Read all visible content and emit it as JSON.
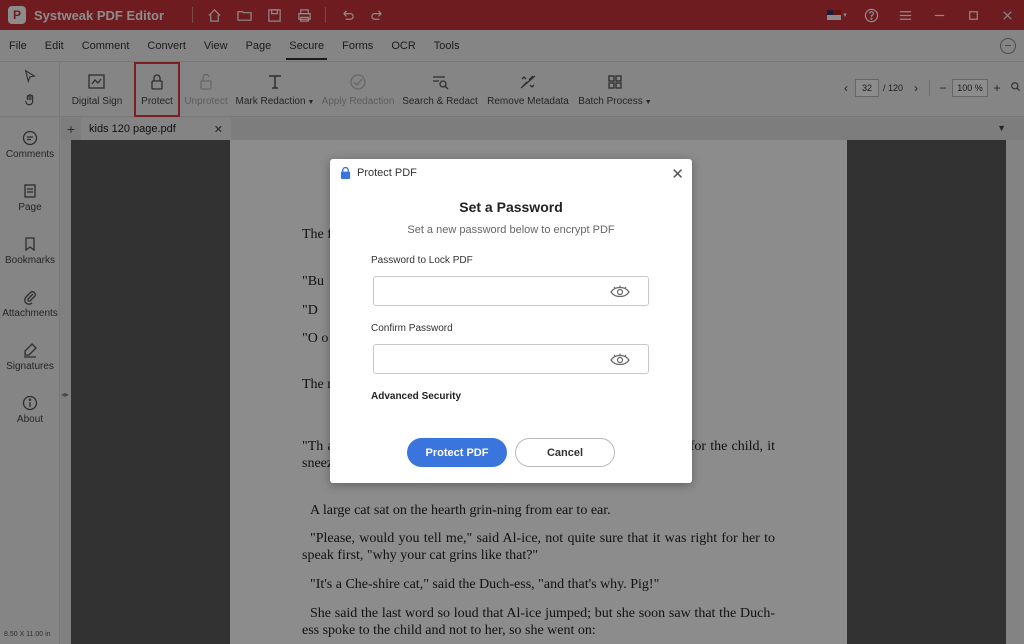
{
  "app": {
    "title": "Systweak PDF Editor"
  },
  "menu": [
    "File",
    "Edit",
    "Comment",
    "Convert",
    "View",
    "Page",
    "Secure",
    "Forms",
    "OCR",
    "Tools"
  ],
  "ribbon": {
    "tools": [
      {
        "label": "Digital Sign"
      },
      {
        "label": "Protect"
      },
      {
        "label": "Unprotect"
      },
      {
        "label": "Mark Redaction"
      },
      {
        "label": "Apply Redaction"
      },
      {
        "label": "Search & Redact"
      },
      {
        "label": "Remove Metadata"
      },
      {
        "label": "Batch Process"
      }
    ],
    "page_current": "32",
    "page_total": "/ 120",
    "zoom": "100 %"
  },
  "sidebar": {
    "items": [
      "Comments",
      "Page",
      "Bookmarks",
      "Attachments",
      "Signatures",
      "About"
    ],
    "page_size": "8.50 X 11.00 in"
  },
  "tab": {
    "title": "kids 120 page.pdf"
  },
  "document": {
    "paragraphs": [
      "The                                                                                                                      f shall sit here on a",
      "\"Bu",
      "\"D",
      "\"O                                                                                                              o sense at all.\" And",
      "The                                                                                                              m end to end: the I                                                                                                              stood near the fire a",
      "\"Th                                                                                                              as well as she coul                                                                                                              the Duch-ess sneezed now and then; and as for the child, it sneezed and howled all the time.",
      "A large cat sat on the hearth grin-ning from ear to ear.",
      "\"Please, would you tell me,\" said Al-ice, not quite sure that it was right for her to speak first, \"why your cat grins like that?\"",
      "\"It's a Che-shire cat,\" said the Duch-ess, \"and that's why. Pig!\"",
      "She said the last word so loud that Al-ice jumped; but she soon saw that the Duch-ess spoke to the child and not to her, so she went on:"
    ]
  },
  "dialog": {
    "header": "Protect PDF",
    "title": "Set a Password",
    "subtitle": "Set a new password below to encrypt PDF",
    "password_label": "Password to Lock PDF",
    "password_value": "",
    "confirm_label": "Confirm Password",
    "confirm_value": "",
    "advanced": "Advanced Security",
    "primary_button": "Protect PDF",
    "cancel_button": "Cancel"
  },
  "colors": {
    "titlebar": "#c8343a",
    "primary": "#3a74dd",
    "highlight": "#e0393e"
  }
}
